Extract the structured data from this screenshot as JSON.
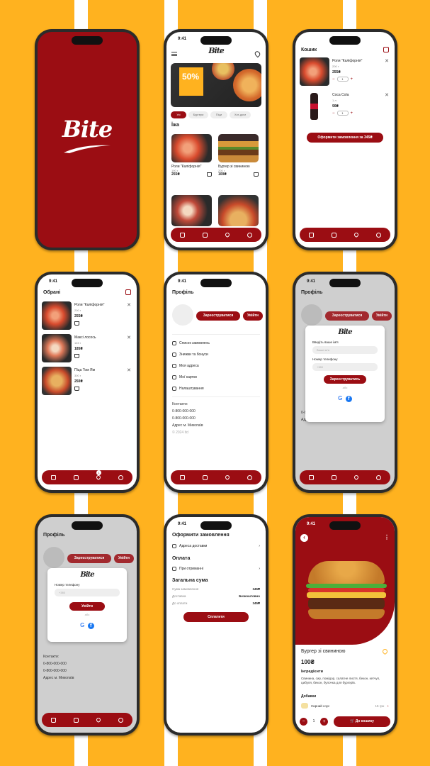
{
  "status_time": "9:41",
  "brand": "Bite",
  "nav_badge": "1",
  "home": {
    "promo": "50%",
    "categories": [
      "Усі",
      "Бургери",
      "Піци",
      "Хот-доги"
    ],
    "section": "Їжа",
    "products": [
      {
        "name": "Роли \"Каліфорнія\"",
        "weight": "190 г",
        "price": "255₴"
      },
      {
        "name": "Бургер зі свининою",
        "weight": "200 г",
        "price": "100₴"
      }
    ]
  },
  "cart": {
    "title": "Кошик",
    "items": [
      {
        "name": "Роли \"Каліфорнія\"",
        "weight": "200 г",
        "price": "255₴",
        "qty": "1"
      },
      {
        "name": "Coca Cola",
        "weight": "1 л",
        "price": "90₴",
        "qty": "1"
      }
    ],
    "checkout": "Оформити замовлення за 345₴"
  },
  "favorites": {
    "title": "Обрані",
    "items": [
      {
        "name": "Роли \"Каліфорнія\"",
        "weight": "200 г",
        "price": "255₴"
      },
      {
        "name": "Максі лосось",
        "weight": "145 г",
        "price": "185₴"
      },
      {
        "name": "Піца Том Ям",
        "weight": "300 г",
        "price": "250₴"
      }
    ]
  },
  "profile": {
    "title": "Профіль",
    "register": "Зареєструватися",
    "login": "Увійти",
    "menu": [
      "Список замовлень",
      "Знижки та бонуси",
      "Моя адреса",
      "Мої картки",
      "Налаштування"
    ],
    "contacts_label": "Контакти:",
    "phones": [
      "0-800-000-000",
      "0-800-000-000"
    ],
    "address": "Адрес м. Миколаїв",
    "copyright": "© 2024 ltd"
  },
  "register_modal": {
    "name_label": "Введіть ваше ім'я",
    "name_placeholder": "Ваше ім'я",
    "phone_label": "Номер телефону",
    "phone_placeholder": "+380",
    "submit": "Зареєструватись",
    "or": "або"
  },
  "login_modal": {
    "phone_label": "Номер телефону",
    "phone_placeholder": "+380",
    "submit": "Увійти",
    "or": "або"
  },
  "checkout": {
    "title": "Оформити замовлення",
    "delivery": "Адреса доставки",
    "payment_title": "Оплата",
    "payment": "При отриманні",
    "total_title": "Загальна сума",
    "rows": [
      {
        "label": "Сума замовлення",
        "value": "345₴"
      },
      {
        "label": "Доставка",
        "value": "Безкоштовно"
      },
      {
        "label": "До оплати",
        "value": "345₴"
      }
    ],
    "pay": "Сплатити"
  },
  "product": {
    "name": "Бургер зі свининою",
    "price": "100₴",
    "ingredients_title": "Інгредієнти",
    "ingredients": "Свинина, сир, помідор, салатне листя, бекон, кетчуп, цибуля, бекон, булочка для бургерів.",
    "addons_title": "Добавки",
    "addon": "Сирний соус",
    "addon_price": "15 грн",
    "qty": "1",
    "add_to_cart": "До кошику"
  },
  "colors": {
    "brand": "#9b0d13",
    "background": "#ffb21f"
  }
}
